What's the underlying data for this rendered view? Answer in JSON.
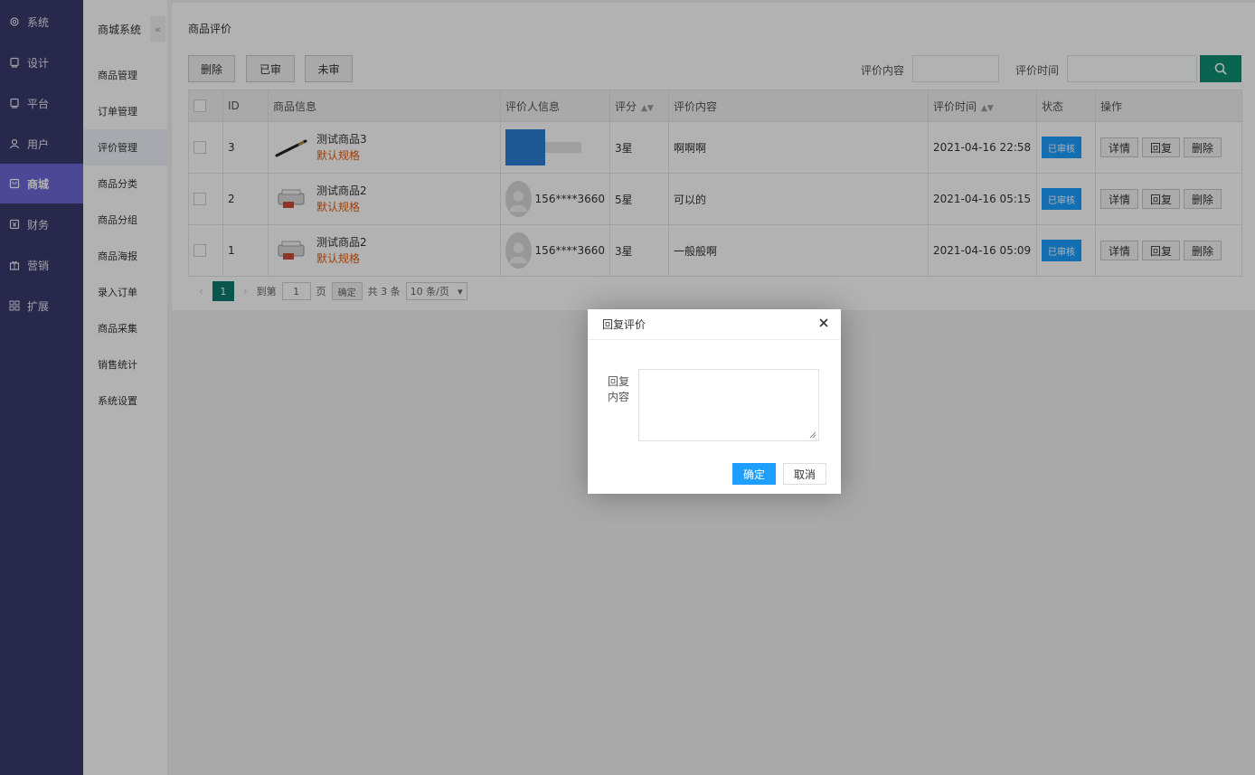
{
  "nav": {
    "items": [
      {
        "label": "系统",
        "icon": "gear-icon"
      },
      {
        "label": "设计",
        "icon": "monitor-icon"
      },
      {
        "label": "平台",
        "icon": "monitor-icon"
      },
      {
        "label": "用户",
        "icon": "user-icon"
      },
      {
        "label": "商城",
        "icon": "shop-icon",
        "active": true
      },
      {
        "label": "财务",
        "icon": "finance-icon"
      },
      {
        "label": "营销",
        "icon": "gift-icon"
      },
      {
        "label": "扩展",
        "icon": "grid-icon"
      }
    ]
  },
  "sub": {
    "title": "商城系统",
    "collapse": "«",
    "items": [
      "商品管理",
      "订单管理",
      "评价管理",
      "商品分类",
      "商品分组",
      "商品海报",
      "录入订单",
      "商品采集",
      "销售统计",
      "系统设置"
    ]
  },
  "page": {
    "title": "商品评价",
    "toolbar": {
      "delete": "删除",
      "approved": "已审",
      "unapproved": "未审"
    },
    "filters": {
      "content_label": "评价内容",
      "time_label": "评价时间"
    }
  },
  "table": {
    "headers": {
      "id": "ID",
      "product": "商品信息",
      "reviewer": "评价人信息",
      "score": "评分",
      "content": "评价内容",
      "time": "评价时间",
      "status": "状态",
      "ops": "操作"
    },
    "rows": [
      {
        "id": "3",
        "product": "测试商品3",
        "spec": "默认规格",
        "reviewer": "",
        "score": "3星",
        "content": "啊啊啊",
        "time": "2021-04-16 22:58",
        "status": "已审核"
      },
      {
        "id": "2",
        "product": "测试商品2",
        "spec": "默认规格",
        "reviewer": "156****3660",
        "score": "5星",
        "content": "可以的",
        "time": "2021-04-16 05:15",
        "status": "已审核"
      },
      {
        "id": "1",
        "product": "测试商品2",
        "spec": "默认规格",
        "reviewer": "156****3660",
        "score": "3星",
        "content": "一般般啊",
        "time": "2021-04-16 05:09",
        "status": "已审核"
      }
    ],
    "ops": {
      "detail": "详情",
      "reply": "回复",
      "delete": "删除"
    }
  },
  "pager": {
    "current": "1",
    "goto_label": "到第",
    "goto_value": "1",
    "page_unit": "页",
    "confirm": "确定",
    "total": "共 3 条",
    "page_size": "10 条/页"
  },
  "modal": {
    "title": "回复评价",
    "field_label": "回复内容",
    "ok": "确定",
    "cancel": "取消"
  },
  "colors": {
    "nav_bg": "#393a6e",
    "nav_active": "#6d67d6",
    "primary": "#1e9fff",
    "search": "#0d8f70",
    "spec": "#e05d14"
  }
}
